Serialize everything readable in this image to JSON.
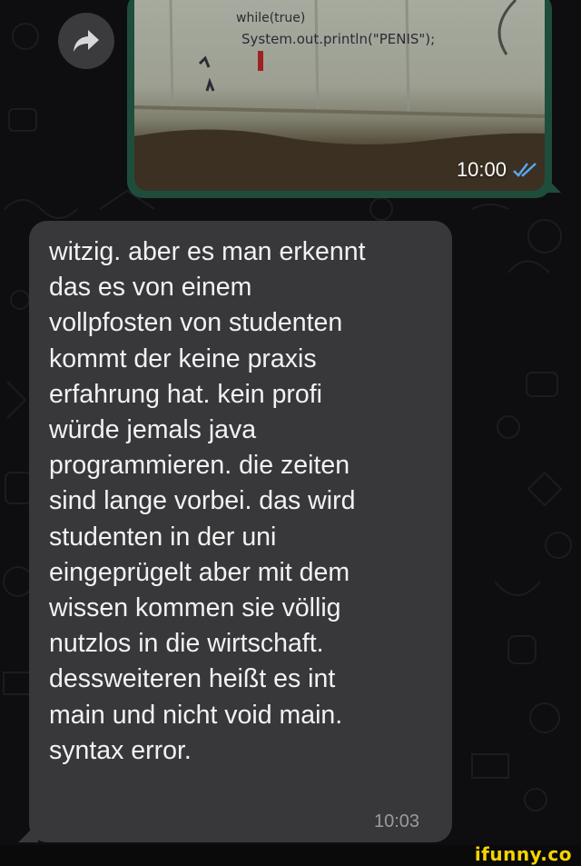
{
  "image_message": {
    "time": "10:00",
    "read_status_icon": "double-check-icon",
    "photo_graffiti": [
      "while(true)",
      "System.out.println(\"PENIS\");"
    ]
  },
  "text_message": {
    "body": "witzig. aber es man erkennt\ndas es von einem\nvollpfosten von studenten\nkommt der keine praxis\nerfahrung hat. kein profi\nwürde jemals java\nprogrammieren. die zeiten\nsind lange vorbei. das wird\nstudenten in der uni\neingeprügelt aber mit dem\nwissen kommen sie völlig\nnutzlos in die wirtschaft.\ndessweiteren heißt es int\nmain und nicht void main.\nsyntax error.",
    "time": "10:03"
  },
  "forward_icon": "forward-arrow-icon",
  "watermark": "ifunny.co",
  "colors": {
    "background": "#0e0e10",
    "sent_bubble": "#1f4d3c",
    "received_bubble": "#38383b",
    "read_check": "#5aa7f0",
    "watermark": "#f5d300"
  }
}
